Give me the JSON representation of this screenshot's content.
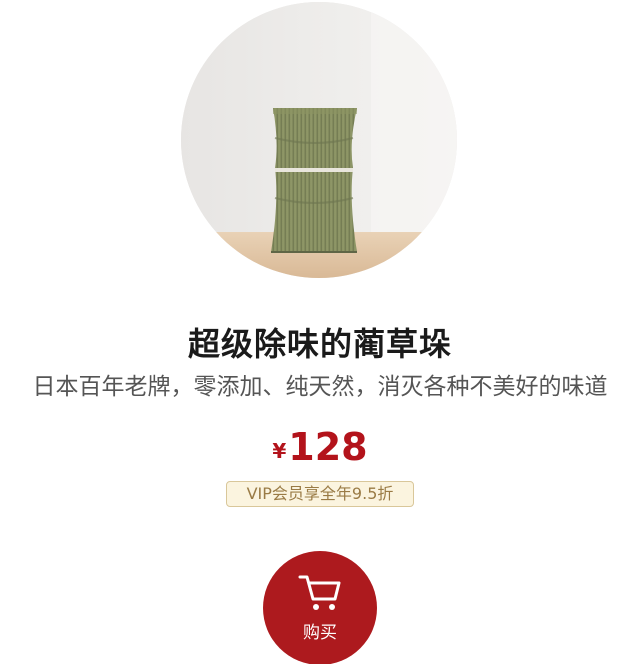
{
  "product": {
    "image_name": "igusa-deodorizer-bundle-photo",
    "title": "超级除味的蔺草垛",
    "subtitle": "日本百年老牌，零添加、纯天然，消灭各种不美好的味道",
    "price": {
      "currency": "¥",
      "amount": "128"
    },
    "vip_badge": "VIP会员享全年9.5折"
  },
  "buy_button": {
    "label": "购买",
    "icon": "cart-icon"
  },
  "colors": {
    "accent": "#ad1a1e",
    "price": "#b3131b",
    "badge_bg": "#fbf4df",
    "badge_border": "#d9c79a",
    "badge_text": "#9a7b45"
  }
}
